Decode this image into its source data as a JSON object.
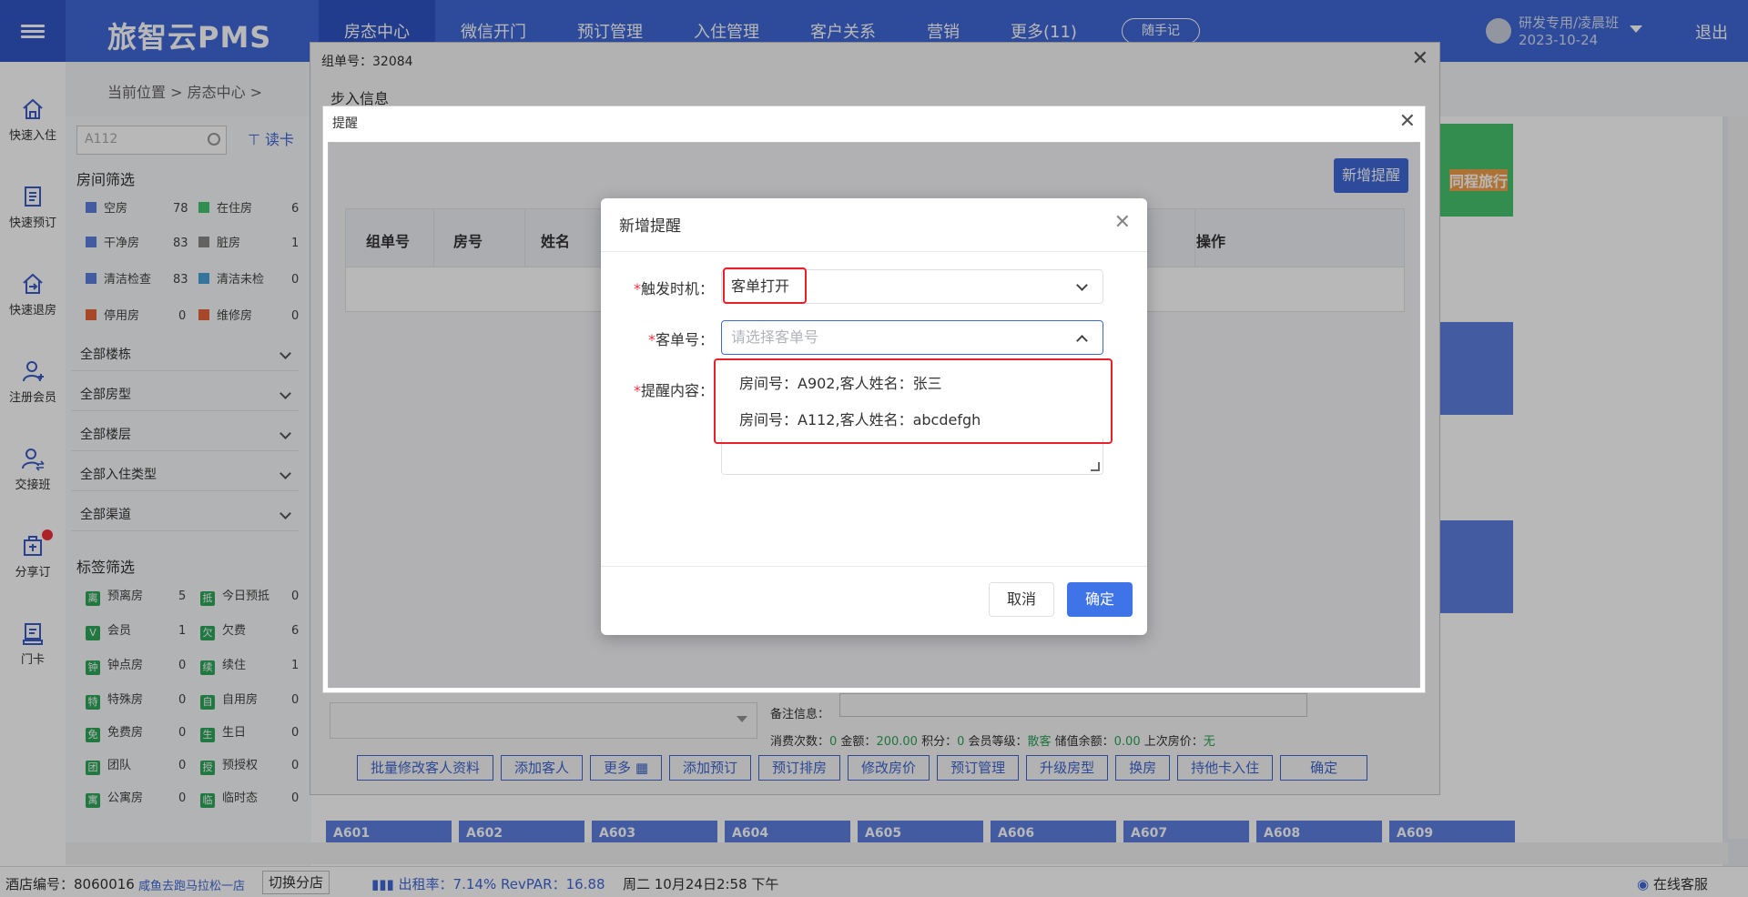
{
  "app": {
    "brand": "旅智云PMS"
  },
  "nav": [
    {
      "label": "房态中心"
    },
    {
      "label": "微信开门"
    },
    {
      "label": "预订管理"
    },
    {
      "label": "入住管理"
    },
    {
      "label": "客户关系"
    },
    {
      "label": "营销"
    },
    {
      "label": "更多(11)"
    }
  ],
  "header": {
    "memo": "随手记",
    "user_line1": "研发专用/凌晨班",
    "user_line2": "2023-10-24",
    "logout": "退出"
  },
  "leftbar": [
    {
      "label": "快速入住",
      "icon": "home-icon"
    },
    {
      "label": "快速预订",
      "icon": "document-icon"
    },
    {
      "label": "快速退房",
      "icon": "checkout-icon"
    },
    {
      "label": "注册会员",
      "icon": "user-add-icon"
    },
    {
      "label": "交接班",
      "icon": "user-switch-icon"
    },
    {
      "label": "分享订",
      "icon": "share-icon"
    },
    {
      "label": "门卡",
      "icon": "card-icon"
    }
  ],
  "breadcrumb": {
    "text": "当前位置 > 房态中心 >"
  },
  "filter": {
    "search_value": "A112",
    "read_card": "读卡",
    "room_filter_title": "房间筛选",
    "room_status": [
      {
        "label": "空房",
        "count": "78",
        "color": "#5d7ee0"
      },
      {
        "label": "在住房",
        "count": "6",
        "color": "#47c46c"
      },
      {
        "label": "干净房",
        "count": "83",
        "color": "#5d7ee0"
      },
      {
        "label": "脏房",
        "count": "1",
        "color": "#888888"
      },
      {
        "label": "清洁检查",
        "count": "83",
        "color": "#5d7ee0"
      },
      {
        "label": "清洁未检",
        "count": "0",
        "color": "#4aa3d8"
      },
      {
        "label": "停用房",
        "count": "0",
        "color": "#e8643a"
      },
      {
        "label": "维修房",
        "count": "0",
        "color": "#e8643a"
      }
    ],
    "dropdowns": [
      "全部楼栋",
      "全部房型",
      "全部楼层",
      "全部入住类型",
      "全部渠道"
    ],
    "tag_filter_title": "标签筛选",
    "tags": [
      {
        "tag": "离",
        "label": "预离房",
        "count": "5"
      },
      {
        "tag": "抵",
        "label": "今日预抵",
        "count": "0"
      },
      {
        "tag": "V",
        "label": "会员",
        "count": "1"
      },
      {
        "tag": "欠",
        "label": "欠费",
        "count": "6"
      },
      {
        "tag": "钟",
        "label": "钟点房",
        "count": "0"
      },
      {
        "tag": "续",
        "label": "续住",
        "count": "1"
      },
      {
        "tag": "特",
        "label": "特殊房",
        "count": "0"
      },
      {
        "tag": "自",
        "label": "自用房",
        "count": "0"
      },
      {
        "tag": "免",
        "label": "免费房",
        "count": "0"
      },
      {
        "tag": "生",
        "label": "生日",
        "count": "0"
      },
      {
        "tag": "团",
        "label": "团队",
        "count": "0"
      },
      {
        "tag": "授",
        "label": "预授权",
        "count": "0"
      },
      {
        "tag": "寓",
        "label": "公寓房",
        "count": "0"
      },
      {
        "tag": "临",
        "label": "临时态",
        "count": "0"
      }
    ]
  },
  "rooms": {
    "labels": [
      "A601",
      "A602",
      "A603",
      "A604",
      "A605",
      "A606",
      "A607",
      "A608",
      "A609"
    ],
    "partial_label": "同程旅行"
  },
  "group_dialog": {
    "title": "组单号：32084",
    "section": "步入信息",
    "remark_label": "备注信息：",
    "stats_a": "消费次数：",
    "stats_a_val": "0",
    "stats_b": " 金额：",
    "stats_b_val": "200.00",
    "stats_c": " 积分：",
    "stats_c_val": "0",
    "stats_d": " 会员等级：",
    "stats_d_val": "散客",
    "stats_e": " 储值余额：",
    "stats_e_val": "0.00",
    "stats_f": " 上次房价：",
    "stats_f_val": "无",
    "actions": [
      "批量修改客人资料",
      "添加客人",
      "更多",
      "添加预订",
      "预订排房",
      "修改房价",
      "预订管理",
      "升级房型",
      "换房",
      "持他卡入住",
      "确定"
    ]
  },
  "reminder_dialog": {
    "title": "提醒",
    "add_button": "新增提醒",
    "columns": [
      {
        "label": "组单号"
      },
      {
        "label": "房号"
      },
      {
        "label": "姓名"
      },
      {
        "label": "操作"
      }
    ]
  },
  "new_reminder": {
    "title": "新增提醒",
    "trigger_label": "触发时机：",
    "trigger_value": "客单打开",
    "order_label": "客单号：",
    "order_placeholder": "请选择客单号",
    "content_label": "提醒内容：",
    "options": [
      "房间号：A902,客人姓名：张三",
      "房间号：A112,客人姓名：abcdefgh"
    ],
    "cancel": "取消",
    "ok": "确定"
  },
  "statusbar": {
    "hotel_no_label": "酒店编号：",
    "hotel_no": "8060016",
    "hotel_name": "咸鱼去跑马拉松一店",
    "switch_branch": "切换分店",
    "occupancy": "出租率：7.14% RevPAR：16.88",
    "datetime": "周二 10月24日2:58 下午",
    "support": "在线客服"
  },
  "colors": {
    "brand_blue": "#3f67d7",
    "highlight_red": "#e8202a",
    "primary_button": "#3f73e8"
  }
}
